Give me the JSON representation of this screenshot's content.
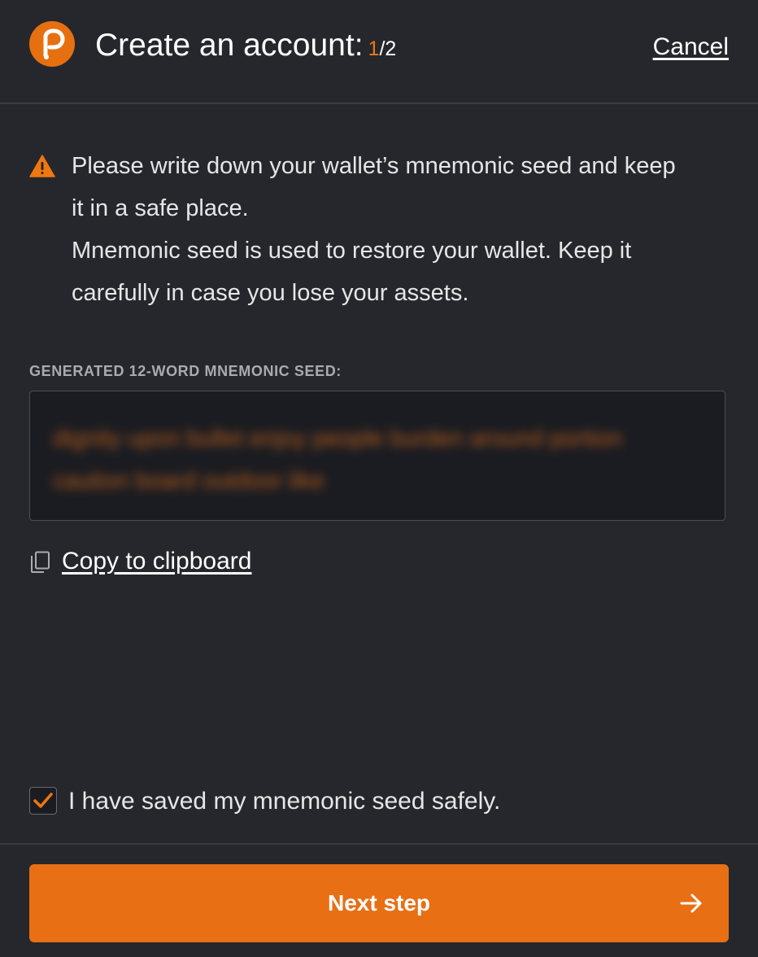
{
  "header": {
    "title": "Create an account:",
    "step_current": "1",
    "step_separator": "/",
    "step_total": "2",
    "cancel_label": "Cancel",
    "logo_icon": "polkadot-logo-icon"
  },
  "warning": {
    "icon": "warning-triangle-icon",
    "line1": "Please write down your wallet’s mnemonic seed and keep it in a safe place.",
    "line2": "Mnemonic seed is used to restore your wallet. Keep it carefully in case you lose your assets."
  },
  "seed": {
    "label": "GENERATED 12-WORD MNEMONIC SEED:",
    "value": "dignity upon bullet enjoy people burden around portion caution board outdoor like",
    "blurred": true
  },
  "copy": {
    "icon": "copy-icon",
    "label": "Copy to clipboard"
  },
  "confirm": {
    "checked": true,
    "label": "I have saved my mnemonic seed safely."
  },
  "footer": {
    "next_label": "Next step",
    "next_icon": "arrow-right-icon"
  },
  "colors": {
    "background": "#25272c",
    "accent": "#e86f14",
    "seed_box": "#1b1c21",
    "divider": "#3a3c41"
  }
}
